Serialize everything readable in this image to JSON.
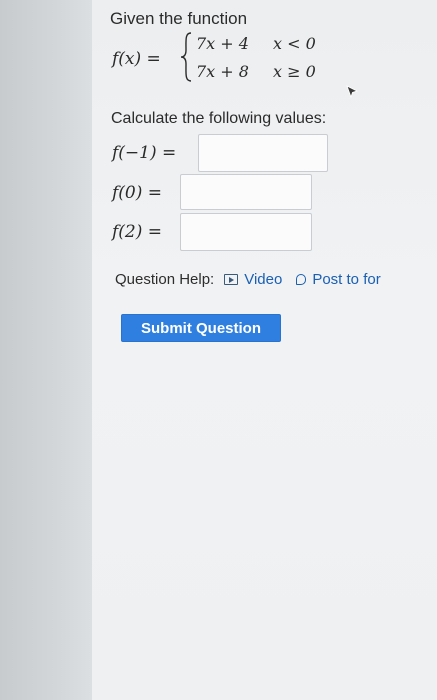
{
  "question": {
    "intro": "Given the function",
    "function": {
      "lhs": "f(x) =",
      "pieces": [
        {
          "expr": "7x + 4",
          "condition": "x < 0"
        },
        {
          "expr": "7x + 8",
          "condition": "x ≥ 0"
        }
      ]
    },
    "instruction": "Calculate the following values:",
    "items": [
      {
        "label": "f(−1) =",
        "value": ""
      },
      {
        "label": "f(0) =",
        "value": ""
      },
      {
        "label": "f(2) =",
        "value": ""
      }
    ]
  },
  "help": {
    "label": "Question Help:",
    "video_link": "Video",
    "post_link": "Post to for",
    "icons": [
      "video-icon",
      "chat-bubble-icon"
    ]
  },
  "actions": {
    "submit_label": "Submit Question",
    "accent": "#2f7fe0",
    "link_color": "#1a5fb4"
  }
}
